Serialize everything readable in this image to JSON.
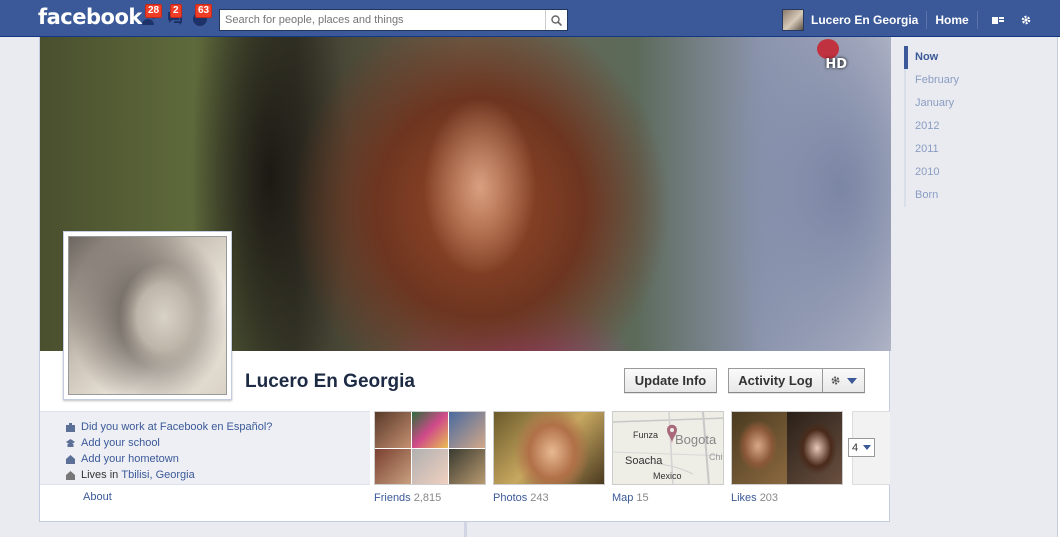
{
  "topbar": {
    "logo": "facebook",
    "badges": {
      "friend_requests": "28",
      "messages": "2",
      "notifications": "63"
    },
    "search_placeholder": "Search for people, places and things",
    "user_name": "Lucero En Georgia",
    "home_label": "Home",
    "icons": [
      "friends-icon",
      "messages-icon",
      "globe-icon",
      "search-icon",
      "privacy-icon",
      "gear-icon"
    ]
  },
  "cover": {
    "hd_label": "HD"
  },
  "profile": {
    "name": "Lucero En Georgia",
    "update_info_label": "Update Info",
    "activity_log_label": "Activity Log"
  },
  "info": {
    "items": [
      {
        "text": "Did you work at Facebook en Español?",
        "icon": "briefcase-icon"
      },
      {
        "text": "Add your school",
        "icon": "school-icon"
      },
      {
        "text": "Add your hometown",
        "icon": "home-icon"
      },
      {
        "prefix": "Lives in",
        "text": "Tbilisi, Georgia",
        "icon": "house-icon"
      }
    ],
    "about_label": "About"
  },
  "apps": [
    {
      "label": "Friends",
      "count": "2,815"
    },
    {
      "label": "Photos",
      "count": "243"
    },
    {
      "label": "Map",
      "count": "15",
      "places": [
        "Funza",
        "Bogota",
        "Soacha",
        "Mexico",
        "Chi"
      ]
    },
    {
      "label": "Likes",
      "count": "203"
    }
  ],
  "more_count": "4",
  "timeline_nav": [
    "Now",
    "February",
    "January",
    "2012",
    "2011",
    "2010",
    "Born"
  ],
  "colors": {
    "brand": "#3b5998",
    "badge": "#f03d25"
  }
}
